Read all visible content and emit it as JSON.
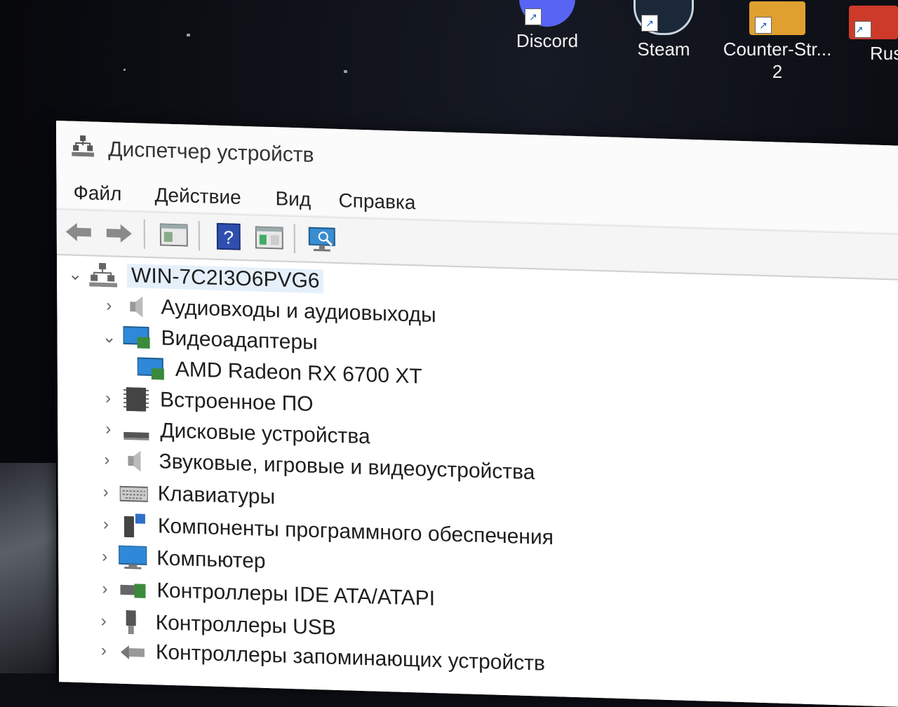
{
  "desktop": {
    "icons": [
      {
        "label": "Discord",
        "color": "#5865f2"
      },
      {
        "label": "Steam",
        "color": "#1b2838"
      },
      {
        "label": "Counter-Str...\n2",
        "color": "#e0a030"
      },
      {
        "label": "Rus",
        "color": "#cd3a2a"
      }
    ]
  },
  "window": {
    "title": "Диспетчер устройств",
    "menu": [
      "Файл",
      "Действие",
      "Вид",
      "Справка"
    ],
    "toolbar": {
      "icons": [
        "back-arrow-icon",
        "forward-arrow-icon",
        "properties-icon",
        "help-icon",
        "show-hidden-icon",
        "scan-hardware-icon"
      ]
    },
    "tree": {
      "root": "WIN-7C2I3O6PVG6",
      "items": [
        {
          "label": "Аудиовходы и аудиовыходы",
          "expanded": false,
          "icon": "speaker-icon"
        },
        {
          "label": "Видеоадаптеры",
          "expanded": true,
          "icon": "display-adapter-icon"
        },
        {
          "label": "AMD Radeon RX 6700 XT",
          "child": true,
          "icon": "display-adapter-icon"
        },
        {
          "label": "Встроенное ПО",
          "expanded": false,
          "icon": "firmware-icon"
        },
        {
          "label": "Дисковые устройства",
          "expanded": false,
          "icon": "disk-icon"
        },
        {
          "label": "Звуковые, игровые и видеоустройства",
          "expanded": false,
          "icon": "speaker-icon"
        },
        {
          "label": "Клавиатуры",
          "expanded": false,
          "icon": "keyboard-icon"
        },
        {
          "label": "Компоненты программного обеспечения",
          "expanded": false,
          "icon": "software-component-icon"
        },
        {
          "label": "Компьютер",
          "expanded": false,
          "icon": "monitor-icon"
        },
        {
          "label": "Контроллеры IDE ATA/ATAPI",
          "expanded": false,
          "icon": "controller-icon"
        },
        {
          "label": "Контроллеры USB",
          "expanded": false,
          "icon": "usb-icon"
        },
        {
          "label": "Контроллеры запоминающих устройств",
          "expanded": false,
          "icon": "storage-controller-icon"
        }
      ]
    }
  }
}
